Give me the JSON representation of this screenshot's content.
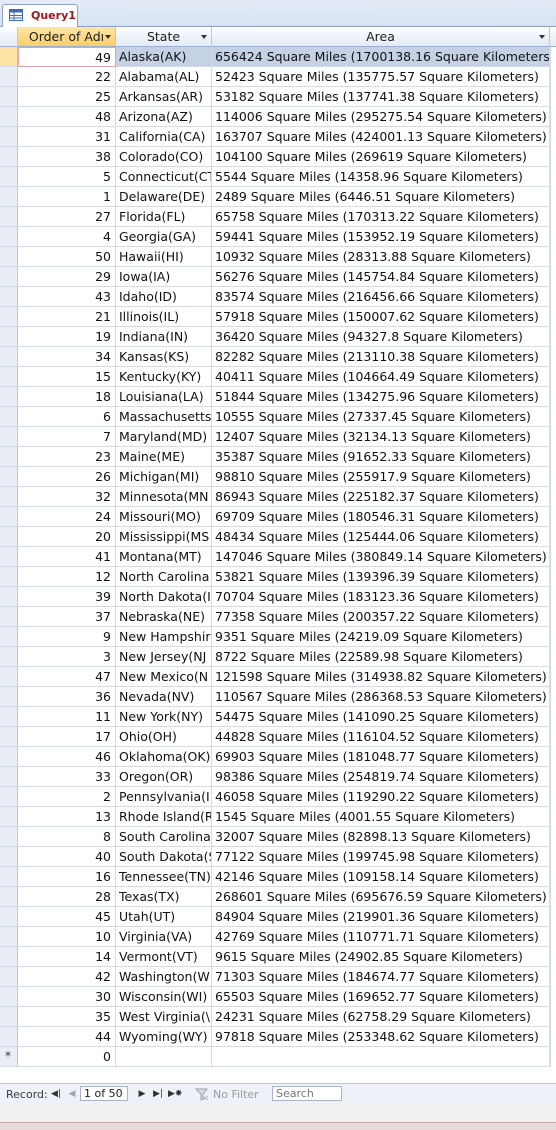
{
  "window": {
    "tab_title": "Query1"
  },
  "columns": {
    "order": "Order of Adı",
    "state": "State",
    "area": "Area"
  },
  "rows": [
    {
      "order": "49",
      "state": "Alaska(AK)",
      "area": "656424 Square Miles (1700138.16 Square Kilometers)"
    },
    {
      "order": "22",
      "state": "Alabama(AL)",
      "area": "52423 Square Miles (135775.57 Square Kilometers)"
    },
    {
      "order": "25",
      "state": "Arkansas(AR)",
      "area": "53182 Square Miles (137741.38 Square Kilometers)"
    },
    {
      "order": "48",
      "state": "Arizona(AZ)",
      "area": "114006 Square Miles (295275.54 Square Kilometers)"
    },
    {
      "order": "31",
      "state": "California(CA)",
      "area": "163707 Square Miles (424001.13 Square Kilometers)"
    },
    {
      "order": "38",
      "state": "Colorado(CO)",
      "area": "104100 Square Miles (269619 Square Kilometers)"
    },
    {
      "order": "5",
      "state": "Connecticut(CT",
      "area": "5544 Square Miles (14358.96 Square Kilometers)"
    },
    {
      "order": "1",
      "state": "Delaware(DE)",
      "area": "2489 Square Miles (6446.51 Square Kilometers)"
    },
    {
      "order": "27",
      "state": "Florida(FL)",
      "area": "65758 Square Miles (170313.22 Square Kilometers)"
    },
    {
      "order": "4",
      "state": "Georgia(GA)",
      "area": "59441 Square Miles (153952.19 Square Kilometers)"
    },
    {
      "order": "50",
      "state": "Hawaii(HI)",
      "area": "10932 Square Miles (28313.88 Square Kilometers)"
    },
    {
      "order": "29",
      "state": "Iowa(IA)",
      "area": "56276 Square Miles (145754.84 Square Kilometers)"
    },
    {
      "order": "43",
      "state": "Idaho(ID)",
      "area": "83574 Square Miles (216456.66 Square Kilometers)"
    },
    {
      "order": "21",
      "state": "Illinois(IL)",
      "area": "57918 Square Miles (150007.62 Square Kilometers)"
    },
    {
      "order": "19",
      "state": "Indiana(IN)",
      "area": "36420 Square Miles (94327.8 Square Kilometers)"
    },
    {
      "order": "34",
      "state": "Kansas(KS)",
      "area": "82282 Square Miles (213110.38 Square Kilometers)"
    },
    {
      "order": "15",
      "state": "Kentucky(KY)",
      "area": "40411 Square Miles (104664.49 Square Kilometers)"
    },
    {
      "order": "18",
      "state": "Louisiana(LA)",
      "area": "51844 Square Miles (134275.96 Square Kilometers)"
    },
    {
      "order": "6",
      "state": "Massachusetts",
      "area": "10555 Square Miles (27337.45 Square Kilometers)"
    },
    {
      "order": "7",
      "state": "Maryland(MD)",
      "area": "12407 Square Miles (32134.13 Square Kilometers)"
    },
    {
      "order": "23",
      "state": "Maine(ME)",
      "area": "35387 Square Miles (91652.33 Square Kilometers)"
    },
    {
      "order": "26",
      "state": "Michigan(MI)",
      "area": "98810 Square Miles (255917.9 Square Kilometers)"
    },
    {
      "order": "32",
      "state": "Minnesota(MN",
      "area": "86943 Square Miles (225182.37 Square Kilometers)"
    },
    {
      "order": "24",
      "state": "Missouri(MO)",
      "area": "69709 Square Miles (180546.31 Square Kilometers)"
    },
    {
      "order": "20",
      "state": "Mississippi(MS",
      "area": "48434 Square Miles (125444.06 Square Kilometers)"
    },
    {
      "order": "41",
      "state": "Montana(MT)",
      "area": "147046 Square Miles (380849.14 Square Kilometers)"
    },
    {
      "order": "12",
      "state": "North Carolina",
      "area": "53821 Square Miles (139396.39 Square Kilometers)"
    },
    {
      "order": "39",
      "state": "North Dakota(I",
      "area": "70704 Square Miles (183123.36 Square Kilometers)"
    },
    {
      "order": "37",
      "state": "Nebraska(NE)",
      "area": "77358 Square Miles (200357.22 Square Kilometers)"
    },
    {
      "order": "9",
      "state": "New Hampshir",
      "area": "9351 Square Miles (24219.09 Square Kilometers)"
    },
    {
      "order": "3",
      "state": "New Jersey(NJ",
      "area": "8722 Square Miles (22589.98 Square Kilometers)"
    },
    {
      "order": "47",
      "state": "New Mexico(N",
      "area": "121598 Square Miles (314938.82 Square Kilometers)"
    },
    {
      "order": "36",
      "state": "Nevada(NV)",
      "area": "110567 Square Miles (286368.53 Square Kilometers)"
    },
    {
      "order": "11",
      "state": "New York(NY)",
      "area": "54475 Square Miles (141090.25 Square Kilometers)"
    },
    {
      "order": "17",
      "state": "Ohio(OH)",
      "area": "44828 Square Miles (116104.52 Square Kilometers)"
    },
    {
      "order": "46",
      "state": "Oklahoma(OK)",
      "area": "69903 Square Miles (181048.77 Square Kilometers)"
    },
    {
      "order": "33",
      "state": "Oregon(OR)",
      "area": "98386 Square Miles (254819.74 Square Kilometers)"
    },
    {
      "order": "2",
      "state": "Pennsylvania(I",
      "area": "46058 Square Miles (119290.22 Square Kilometers)"
    },
    {
      "order": "13",
      "state": "Rhode Island(R",
      "area": "1545 Square Miles (4001.55 Square Kilometers)"
    },
    {
      "order": "8",
      "state": "South Carolina",
      "area": "32007 Square Miles (82898.13 Square Kilometers)"
    },
    {
      "order": "40",
      "state": "South Dakota(S",
      "area": "77122 Square Miles (199745.98 Square Kilometers)"
    },
    {
      "order": "16",
      "state": "Tennessee(TN)",
      "area": "42146 Square Miles (109158.14 Square Kilometers)"
    },
    {
      "order": "28",
      "state": "Texas(TX)",
      "area": "268601 Square Miles (695676.59 Square Kilometers)"
    },
    {
      "order": "45",
      "state": "Utah(UT)",
      "area": "84904 Square Miles (219901.36 Square Kilometers)"
    },
    {
      "order": "10",
      "state": "Virginia(VA)",
      "area": "42769 Square Miles (110771.71 Square Kilometers)"
    },
    {
      "order": "14",
      "state": "Vermont(VT)",
      "area": "9615 Square Miles (24902.85 Square Kilometers)"
    },
    {
      "order": "42",
      "state": "Washington(W",
      "area": "71303 Square Miles (184674.77 Square Kilometers)"
    },
    {
      "order": "30",
      "state": "Wisconsin(WI)",
      "area": "65503 Square Miles (169652.77 Square Kilometers)"
    },
    {
      "order": "35",
      "state": "West Virginia(\\",
      "area": "24231 Square Miles (62758.29 Square Kilometers)"
    },
    {
      "order": "44",
      "state": "Wyoming(WY)",
      "area": "97818 Square Miles (253348.62 Square Kilometers)"
    }
  ],
  "new_row": {
    "marker": "*",
    "order": "0"
  },
  "nav": {
    "record_label": "Record:",
    "current": "1 of 50",
    "filter_label": "No Filter",
    "search_placeholder": "Search"
  }
}
